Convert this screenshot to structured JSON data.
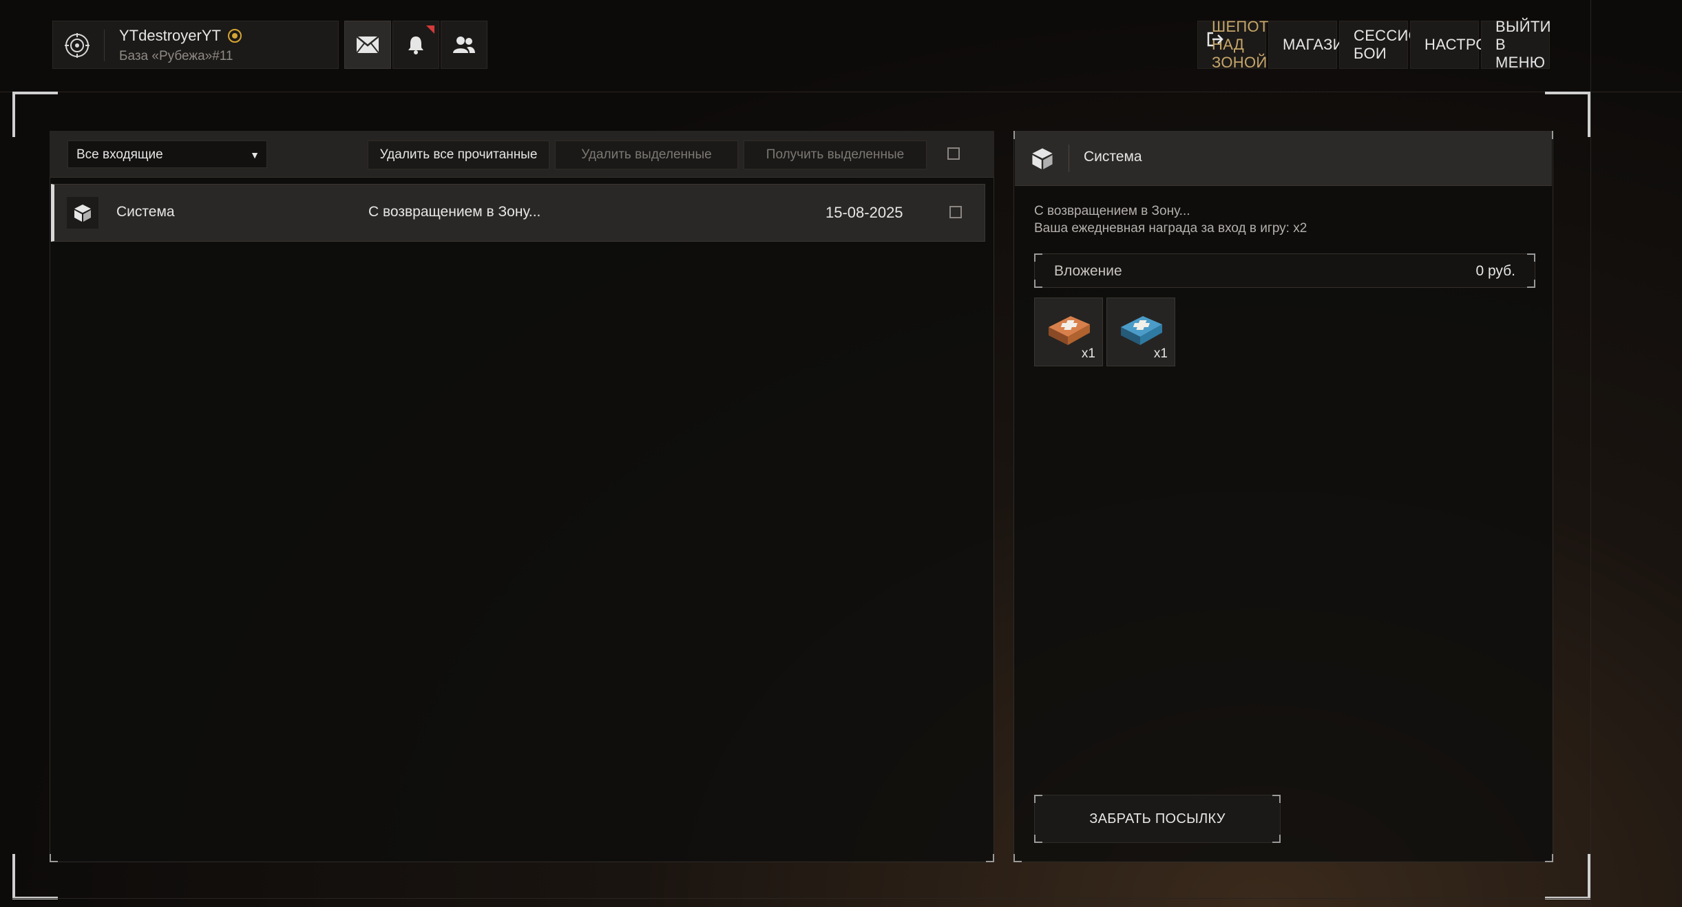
{
  "profile": {
    "username": "YTdestroyerYT",
    "base": "База «Рубежа»#11"
  },
  "topbar": {
    "icons": [
      "mail-icon",
      "bell-icon",
      "friends-icon"
    ],
    "nav": [
      {
        "label": "ШЕПОТ НАД ЗОНОЙ"
      },
      {
        "label": "МАГАЗИН"
      },
      {
        "label": "СЕССИОННЫЕ БОИ"
      },
      {
        "label": "НАСТРОЙКИ"
      },
      {
        "label": "ВЫЙТИ В МЕНЮ"
      }
    ],
    "accent_color": "#c7a66a",
    "notification_color": "#d33a3a"
  },
  "inbox": {
    "filter_value": "Все входящие",
    "delete_read_label": "Удалить все прочитанные",
    "delete_selected_label": "Удалить выделенные",
    "receive_selected_label": "Получить выделенные",
    "messages": [
      {
        "sender": "Система",
        "subject": "С возвращением в Зону...",
        "date": "15-08-2025"
      }
    ]
  },
  "detail": {
    "sender": "Система",
    "body_line1": "С возвращением в Зону...",
    "body_line2": "Ваша ежедневная награда за вход в игру: x2",
    "attachment_label": "Вложение",
    "attachment_value": "0 руб.",
    "items": [
      {
        "icon": "medkit-orange-icon",
        "qty": "x1"
      },
      {
        "icon": "medkit-blue-icon",
        "qty": "x1"
      }
    ],
    "claim_label": "ЗАБРАТЬ ПОСЫЛКУ"
  }
}
